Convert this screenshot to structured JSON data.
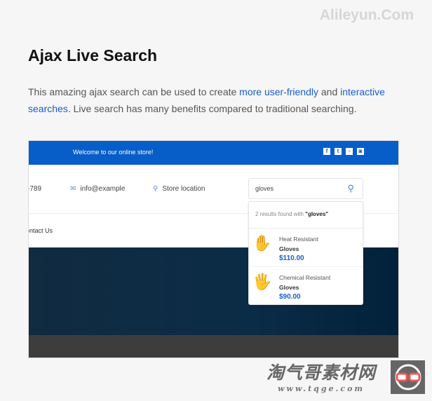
{
  "watermark_top": "Alileyun.Com",
  "title": "Ajax Live Search",
  "intro": {
    "t1": "This amazing ajax search can be  used to create ",
    "l1": "more user-friendly",
    "t2": " and ",
    "l2": "interactive searches",
    "t3": ". Live search has many benefits compared to traditional searching."
  },
  "store": {
    "welcome": "Welcome to our online store!",
    "social": [
      "facebook-icon",
      "twitter-icon",
      "youtube-icon",
      "instagram-icon"
    ],
    "phone": "-789",
    "email": "info@example",
    "location": "Store location",
    "search_value": "gloves",
    "nav_item": "ontact Us",
    "dropdown": {
      "count_text": "2 results found with ",
      "query": "\"gloves\"",
      "results": [
        {
          "line1": "Heat Resistant",
          "line2": "Gloves",
          "price": "$110.00"
        },
        {
          "line1": "Chemical Resistant",
          "line2": "Gloves",
          "price": "$90.00"
        }
      ]
    }
  },
  "watermark_bottom": {
    "cn": "淘气哥素材网",
    "url": "www.tqge.com"
  },
  "colors": {
    "brand": "#075ec9",
    "link": "#1a5dcc"
  }
}
